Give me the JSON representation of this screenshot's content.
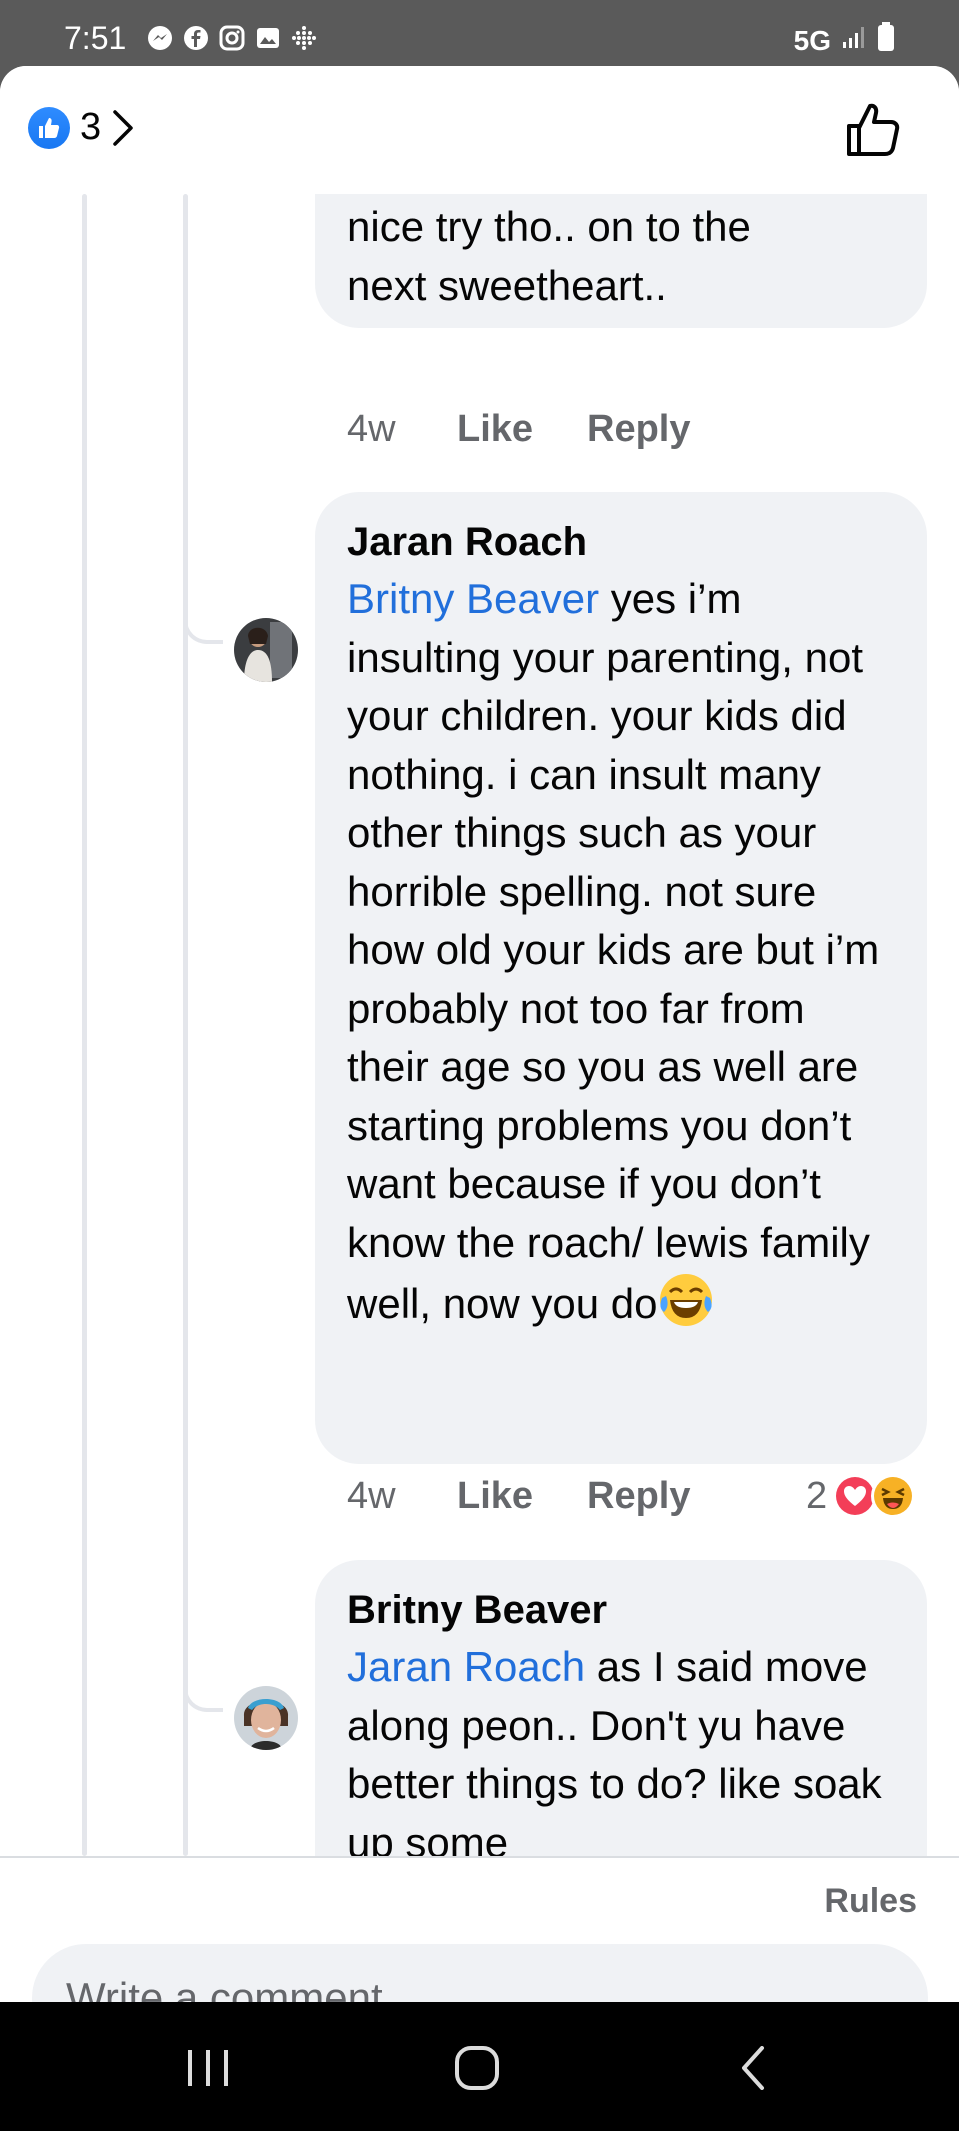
{
  "status_bar": {
    "time": "7:51",
    "network": "5G",
    "icons": [
      "messenger-icon",
      "facebook-icon",
      "instagram-icon",
      "gallery-icon",
      "dots-grid-icon"
    ]
  },
  "header": {
    "reaction_count": "3",
    "reaction_icon": "like-icon",
    "action_icon": "thumbs-up-outline-icon"
  },
  "comments": [
    {
      "author": "",
      "text_lines": "nice try tho.. on to the next sweetheart..",
      "time": "4w",
      "like_label": "Like",
      "reply_label": "Reply"
    },
    {
      "author": "Jaran Roach",
      "mention": "Britny Beaver",
      "text": " yes i’m insulting your parenting, not your children. your kids did nothing. i can insult many other things such as your horrible spelling. not sure how old your kids are but i’m probably not too far from their age so you as well are starting problems you don’t want because if you don’t know the roach/ lewis family well, now you do",
      "emoji": "laughing-tears-emoji",
      "time": "4w",
      "like_label": "Like",
      "reply_label": "Reply",
      "reaction_count": "2",
      "reactions": [
        "love-icon",
        "haha-icon"
      ]
    },
    {
      "author": "Britny Beaver",
      "mention": "Jaran Roach",
      "text": " as I said move along peon.. Don't yu have better things to do? like soak up some"
    }
  ],
  "composer": {
    "rules_label": "Rules",
    "placeholder": "Write a comment…"
  },
  "colors": {
    "accent": "#1877f2",
    "mention": "#216fdb",
    "bubble": "#f0f2f5",
    "secondary_text": "#65676b",
    "love": "#f33e58",
    "haha": "#f7b125"
  }
}
